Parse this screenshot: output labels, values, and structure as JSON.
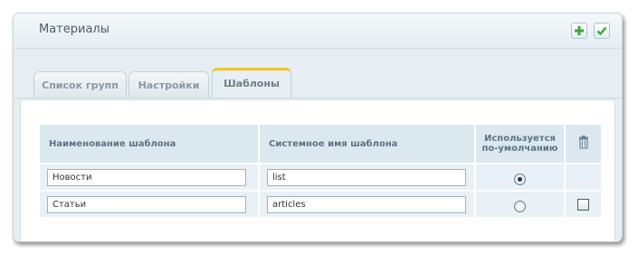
{
  "panel": {
    "title": "Материалы",
    "add_icon": "plus-icon",
    "save_icon": "check-icon"
  },
  "tabs": [
    {
      "label": "Список групп",
      "active": false
    },
    {
      "label": "Настройки",
      "active": false
    },
    {
      "label": "Шаблоны",
      "active": true
    }
  ],
  "table": {
    "headers": {
      "name": "Наименование шаблона",
      "system_name": "Системное имя шаблона",
      "default_line1": "Используется",
      "default_line2": "по-умолчанию",
      "delete_icon": "trash-icon"
    },
    "rows": [
      {
        "name": "Новости",
        "system_name": "list",
        "is_default": true,
        "deletable": false
      },
      {
        "name": "Статьи",
        "system_name": "articles",
        "is_default": false,
        "deletable": true
      }
    ]
  },
  "colors": {
    "active_tab_accent": "#f2c22e",
    "add_icon": "#3aa83a",
    "save_icon": "#3aa83a"
  }
}
